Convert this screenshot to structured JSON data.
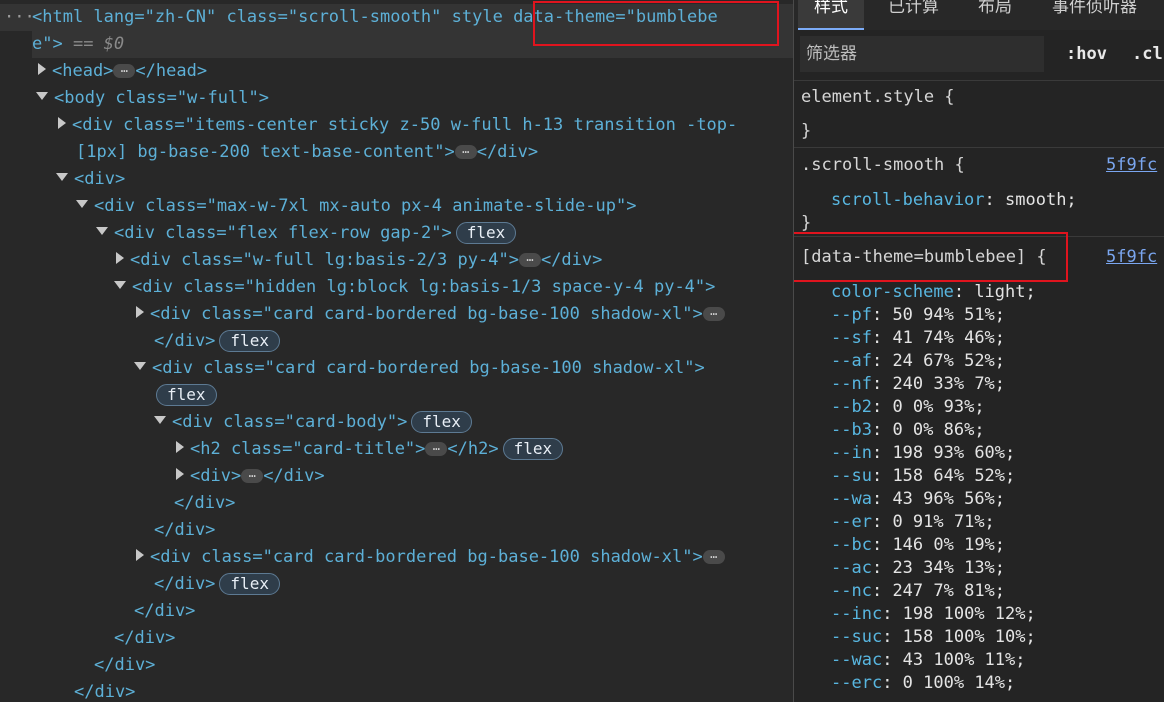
{
  "elements": {
    "row0_a": "<html lang=\"zh-CN\" class=\"scroll-smooth\" style",
    "row0_b": "data-theme=\"bumblebe",
    "row1_a": "e\">",
    "row1_b": "== $0",
    "row2": "<head>",
    "row2_end": "</head>",
    "row3": "<body class=\"w-full\">",
    "row4": "<div class=\"items-center sticky z-50 w-full h-13 transition -top-",
    "row5": "[1px] bg-base-200 text-base-content\">",
    "row5_end": "</div>",
    "row6": "<div>",
    "row7": "<div class=\"max-w-7xl mx-auto px-4 animate-slide-up\">",
    "row8": "<div class=\"flex flex-row gap-2\">",
    "row9": "<div class=\"w-full lg:basis-2/3 py-4\">",
    "row9_end": "</div>",
    "row10": "<div class=\"hidden lg:block lg:basis-1/3 space-y-4 py-4\">",
    "row11": "<div class=\"card card-bordered bg-base-100 shadow-xl\">",
    "row12": "</div>",
    "row13": "<div class=\"card card-bordered bg-base-100 shadow-xl\">",
    "row15": "<div class=\"card-body\">",
    "row16": "<h2 class=\"card-title\">",
    "row16_end": "</h2>",
    "row17": "<div>",
    "row17_end": "</div>",
    "row18": "</div>",
    "row19": "</div>",
    "row20": "<div class=\"card card-bordered bg-base-100 shadow-xl\">",
    "row21": "</div>",
    "row22": "</div>",
    "row23": "</div>",
    "row24": "</div>",
    "row25": "</div>",
    "badge_flex": "flex",
    "ellipsis": "…",
    "left_dots": "···"
  },
  "styles_panel": {
    "tabs": [
      "样式",
      "已计算",
      "布局",
      "事件侦听器"
    ],
    "filter_placeholder": "筛选器",
    "hov": ":hov",
    "cls": ".cl",
    "rule1_selector": "element.style {",
    "rule1_close": "}",
    "rule2_selector": ".scroll-smooth {",
    "rule2_source": "5f9fc",
    "rule2_prop": "scroll-behavior",
    "rule2_value": "smooth;",
    "rule2_close": "}",
    "rule3_selector": "[data-theme=bumblebee] {",
    "rule3_source": "5f9fc",
    "declarations": [
      {
        "prop": "color-scheme",
        "value": "light;"
      },
      {
        "prop": "--pf",
        "value": "50 94% 51%;"
      },
      {
        "prop": "--sf",
        "value": "41 74% 46%;"
      },
      {
        "prop": "--af",
        "value": "24 67% 52%;"
      },
      {
        "prop": "--nf",
        "value": "240 33% 7%;"
      },
      {
        "prop": "--b2",
        "value": "0 0% 93%;"
      },
      {
        "prop": "--b3",
        "value": "0 0% 86%;"
      },
      {
        "prop": "--in",
        "value": "198 93% 60%;"
      },
      {
        "prop": "--su",
        "value": "158 64% 52%;"
      },
      {
        "prop": "--wa",
        "value": "43 96% 56%;"
      },
      {
        "prop": "--er",
        "value": "0 91% 71%;"
      },
      {
        "prop": "--bc",
        "value": "146 0% 19%;"
      },
      {
        "prop": "--ac",
        "value": "23 34% 13%;"
      },
      {
        "prop": "--nc",
        "value": "247 7% 81%;"
      },
      {
        "prop": "--inc",
        "value": "198 100% 12%;"
      },
      {
        "prop": "--suc",
        "value": "158 100% 10%;"
      },
      {
        "prop": "--wac",
        "value": "43 100% 11%;"
      },
      {
        "prop": "--erc",
        "value": "0 100% 14%;"
      }
    ]
  },
  "colors": {
    "highlight_box": "#e0141e",
    "tag": "#5db0d7",
    "attr_value": "#f29766",
    "css_property": "#58b6e0",
    "link": "#7aa6f0"
  }
}
